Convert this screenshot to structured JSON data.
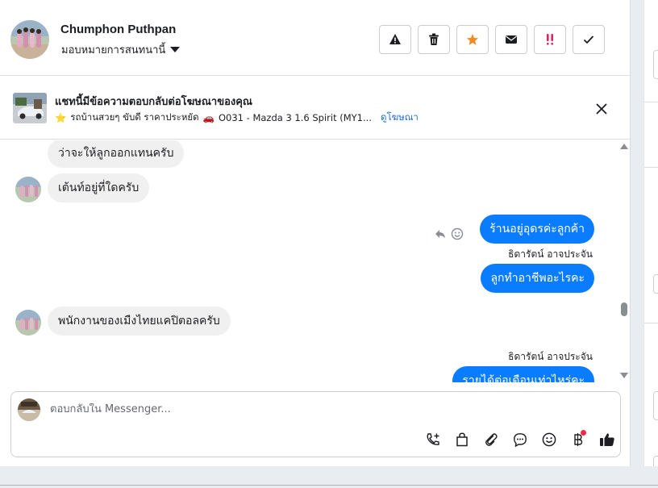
{
  "header": {
    "contact_name": "Chumphon Puthpan",
    "assignment_label": "มอบหมายการสนทนานี้",
    "actions": [
      {
        "name": "warning-button",
        "icon": "warning-icon"
      },
      {
        "name": "delete-button",
        "icon": "trash-icon"
      },
      {
        "name": "star-button",
        "icon": "star-icon"
      },
      {
        "name": "mark-unread-button",
        "icon": "envelope-icon"
      },
      {
        "name": "spam-button",
        "icon": "exclamation-icon"
      },
      {
        "name": "done-button",
        "icon": "check-icon"
      }
    ]
  },
  "ad": {
    "title": "แชทนี้มีข้อความตอบกลับต่อโฆษณาของคุณ",
    "star": "⭐",
    "car": "🚗",
    "subtitle_part1": "รถบ้านสวยๆ ขับดี ราคาประหยัด",
    "subtitle_part2": "O031 - Mazda 3 1.6 Spirit (MY1...",
    "link": "ดูโฆษณา"
  },
  "messages": {
    "m1": "ว่าจะให้ลูกออกแทนครับ",
    "m2": "เต้นท์อยู่ที่ใดครับ",
    "m3": "ร้านอยู่อุดรค่ะลูกค้า",
    "m3_sender": "ธิดารัตน์ อาจประจัน",
    "m4": "ลูกทำอาชีพอะไรคะ",
    "m5": "พนักงานของเมืงไทยแคปิตอลครับ",
    "m6_sender": "ธิดารัตน์ อาจประจัน",
    "m6": "รายได้ต่อเดือนเท่าไหร่คะ"
  },
  "composer": {
    "placeholder": "ตอบกลับใน Messenger...",
    "tools": [
      "call-add-icon",
      "bag-icon",
      "paperclip-icon",
      "chat-bubble-icon",
      "emoji-icon",
      "baht-icon",
      "thumbs-up-icon"
    ]
  },
  "colors": {
    "accent": "#0a7cff",
    "link": "#216fdb",
    "incoming": "#f0f0f0",
    "star": "#f28b1e",
    "spam": "#e0245e",
    "notification": "#f0284a"
  }
}
